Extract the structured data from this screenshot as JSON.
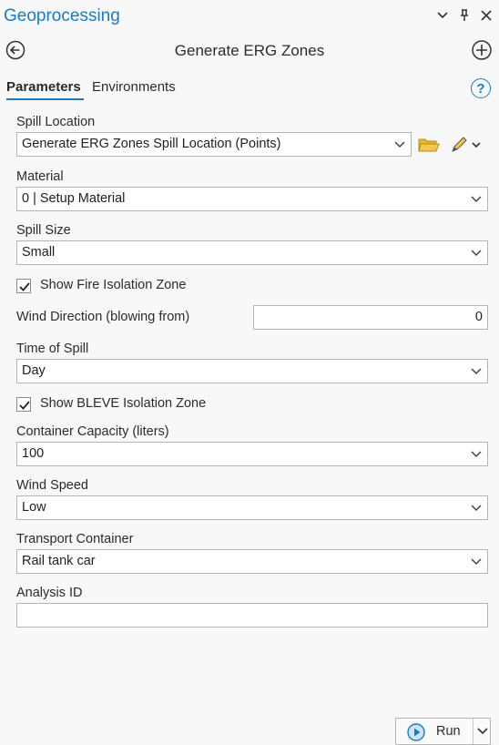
{
  "panel": {
    "title": "Geoprocessing"
  },
  "tool": {
    "name": "Generate ERG Zones"
  },
  "tabs": [
    {
      "label": "Parameters",
      "active": true
    },
    {
      "label": "Environments",
      "active": false
    }
  ],
  "params": {
    "spill_location": {
      "label": "Spill Location",
      "value": "Generate ERG Zones Spill Location (Points)"
    },
    "material": {
      "label": "Material",
      "value": "0 | Setup Material"
    },
    "spill_size": {
      "label": "Spill Size",
      "value": "Small"
    },
    "show_fire": {
      "label": "Show Fire Isolation Zone",
      "checked": true
    },
    "wind_direction": {
      "label": "Wind Direction (blowing from)",
      "value": "0"
    },
    "time_of_spill": {
      "label": "Time of Spill",
      "value": "Day"
    },
    "show_bleve": {
      "label": "Show BLEVE Isolation Zone",
      "checked": true
    },
    "container_capacity": {
      "label": "Container Capacity (liters)",
      "value": "100"
    },
    "wind_speed": {
      "label": "Wind Speed",
      "value": "Low"
    },
    "transport_container": {
      "label": "Transport Container",
      "value": "Rail tank car"
    },
    "analysis_id": {
      "label": "Analysis ID",
      "value": ""
    }
  },
  "run": {
    "label": "Run"
  },
  "colors": {
    "accent": "#1a7bc4",
    "folder": "#e8b631"
  },
  "icons": {
    "panel_controls": [
      "chevron-down-icon",
      "pin-icon",
      "close-icon"
    ],
    "back": "back-arrow-icon",
    "add": "add-circle-icon",
    "help": "help-icon"
  }
}
